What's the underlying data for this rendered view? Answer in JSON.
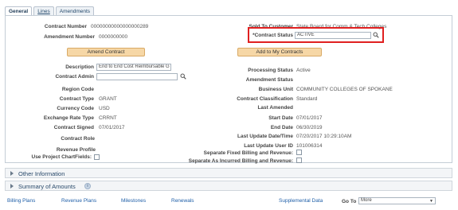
{
  "tabs": [
    {
      "label": "General"
    },
    {
      "label": "Lines"
    },
    {
      "label": "Amendments"
    }
  ],
  "left": {
    "contract_number_label": "Contract Number",
    "contract_number_value": "00000000000000000289",
    "amendment_number_label": "Amendment Number",
    "amendment_number_value": "0000000000",
    "amend_contract_btn": "Amend Contract",
    "description_label": "Description",
    "description_value": "End to End Cost Reimbursable G",
    "contract_admin_label": "Contract Admin",
    "contract_admin_value": "",
    "region_code_label": "Region Code",
    "contract_type_label": "Contract Type",
    "contract_type_value": "GRANT",
    "currency_code_label": "Currency Code",
    "currency_code_value": "USD",
    "exchange_rate_type_label": "Exchange Rate Type",
    "exchange_rate_type_value": "CRRNT",
    "contract_signed_label": "Contract Signed",
    "contract_signed_value": "07/01/2017",
    "contract_role_label": "Contract Role",
    "revenue_profile_label": "Revenue Profile",
    "use_project_chartfields_label": "Use Project ChartFields:"
  },
  "right": {
    "sold_to_customer_label": "Sold To Customer",
    "sold_to_customer_value": "State Board for Comm & Tech Colleges",
    "contract_status_label": "*Contract Status",
    "contract_status_value": "ACTIVE",
    "add_to_my_contracts_btn": "Add to My Contracts",
    "processing_status_label": "Processing Status",
    "processing_status_value": "Active",
    "amendment_status_label": "Amendment Status",
    "business_unit_label": "Business Unit",
    "business_unit_value": "COMMUNITY COLLEGES OF SPOKANE",
    "contract_classification_label": "Contract Classification",
    "contract_classification_value": "Standard",
    "last_amended_label": "Last Amended",
    "start_date_label": "Start Date",
    "start_date_value": "07/01/2017",
    "end_date_label": "End Date",
    "end_date_value": "06/30/2019",
    "last_update_label": "Last Update Date/Time",
    "last_update_value": "07/20/2017 10:29:10AM",
    "last_update_user_label": "Last Update User ID",
    "last_update_user_value": "101006314",
    "sep_fixed_billing_label": "Separate Fixed Billing and Revenue:",
    "sep_incurred_billing_label": "Separate As Incurred Billing and Revenue:"
  },
  "sections": {
    "other_information": "Other Information",
    "summary_of_amounts": "Summary of Amounts"
  },
  "footer": {
    "billing_plans": "Billing Plans",
    "revenue_plans": "Revenue Plans",
    "milestones": "Milestones",
    "renewals": "Renewals",
    "supplemental_data": "Supplemental Data",
    "go_to_label": "Go To",
    "go_to_value": "More"
  },
  "colors": {
    "highlight": "#e02020",
    "button": "#f6d7a6",
    "link": "#1f5fa8"
  }
}
